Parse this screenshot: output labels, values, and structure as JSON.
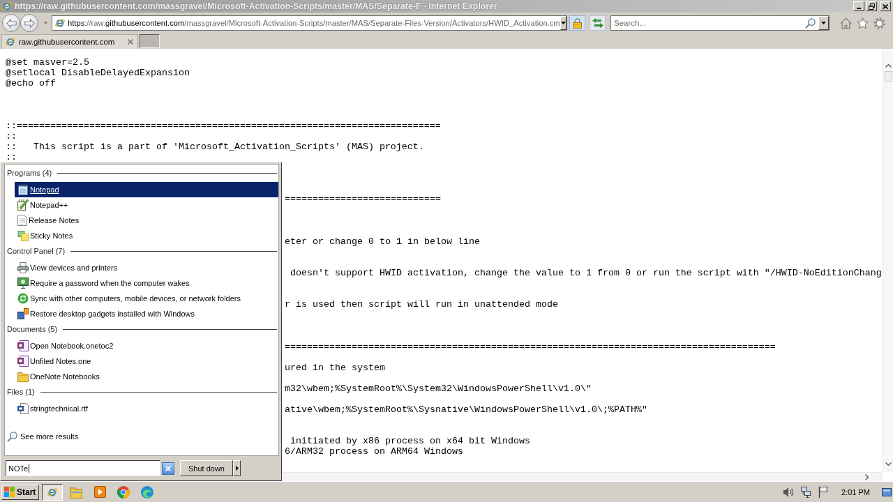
{
  "window": {
    "title": "https://raw.githubusercontent.com/massgravel/Microsoft-Activation-Scripts/master/MAS/Separate-F - Internet Explorer"
  },
  "address_bar": {
    "url": [
      {
        "text": "https",
        "kind": "plain"
      },
      {
        "text": "://raw.",
        "kind": "dim"
      },
      {
        "text": "githubusercontent.com",
        "kind": "plain"
      },
      {
        "text": "/massgravel/Microsoft-Activation-Scripts/master/MAS/Separate-Files-Version/Activators/HWID_Activation.cm",
        "kind": "dim"
      }
    ]
  },
  "search_box": {
    "placeholder": "Search..."
  },
  "tabs": [
    {
      "label": "raw.githubusercontent.com",
      "selected": true
    }
  ],
  "document": {
    "lines": [
      {
        "kind": "code",
        "text": "@set masver=2.5"
      },
      {
        "kind": "code",
        "text": "@setlocal DisableDelayedExpansion"
      },
      {
        "kind": "code",
        "text": "@echo off"
      },
      {
        "kind": "blank"
      },
      {
        "kind": "blank"
      },
      {
        "kind": "blank"
      },
      {
        "kind": "code",
        "text": "::============================================================================"
      },
      {
        "kind": "code",
        "text": "::"
      },
      {
        "kind": "code",
        "text": "::   This script is a part of 'Microsoft_Activation_Scripts' (MAS) project."
      },
      {
        "kind": "code",
        "text": "::"
      },
      {
        "kind": "blank"
      },
      {
        "kind": "blank"
      },
      {
        "kind": "blank"
      },
      {
        "kind": "covered",
        "text": "============================"
      },
      {
        "kind": "blank"
      },
      {
        "kind": "blank"
      },
      {
        "kind": "blank"
      },
      {
        "kind": "covered",
        "text": "eter or change 0 to 1 in below line"
      },
      {
        "kind": "blank"
      },
      {
        "kind": "blank"
      },
      {
        "kind": "covered",
        "text": " doesn't support HWID activation, change the value to 1 from 0 or run the script with \"/HWID-NoEditionChang"
      },
      {
        "kind": "blank"
      },
      {
        "kind": "blank"
      },
      {
        "kind": "covered",
        "text": "r is used then script will run in unattended mode"
      },
      {
        "kind": "blank"
      },
      {
        "kind": "blank"
      },
      {
        "kind": "blank"
      },
      {
        "kind": "covered",
        "text": "========================================================================================"
      },
      {
        "kind": "blank"
      },
      {
        "kind": "covered",
        "text": "ured in the system"
      },
      {
        "kind": "blank"
      },
      {
        "kind": "covered",
        "text": "m32\\wbem;%SystemRoot%\\System32\\WindowsPowerShell\\v1.0\\\""
      },
      {
        "kind": "blank"
      },
      {
        "kind": "covered",
        "text": "ative\\wbem;%SystemRoot%\\Sysnative\\WindowsPowerShell\\v1.0\\;%PATH%\""
      },
      {
        "kind": "blank"
      },
      {
        "kind": "blank"
      },
      {
        "kind": "covered",
        "text": " initiated by x86 process on x64 bit Windows"
      },
      {
        "kind": "covered",
        "text": "6/ARM32 process on ARM64 Windows"
      }
    ]
  },
  "start_menu": {
    "sections": [
      {
        "title": "Programs (4)",
        "items": [
          {
            "label": "Notepad",
            "selected": true
          },
          {
            "label": "Notepad++",
            "selected": false
          },
          {
            "label": "Release Notes",
            "selected": false
          },
          {
            "label": "Sticky Notes",
            "selected": false
          }
        ]
      },
      {
        "title": "Control Panel (7)",
        "items": [
          {
            "label": "View devices and printers",
            "selected": false
          },
          {
            "label": "Require a password when the computer wakes",
            "selected": false
          },
          {
            "label": "Sync with other computers, mobile devices, or network folders",
            "selected": false
          },
          {
            "label": "Restore desktop gadgets installed with Windows",
            "selected": false
          }
        ]
      },
      {
        "title": "Documents (5)",
        "items": [
          {
            "label": "Open Notebook.onetoc2",
            "selected": false
          },
          {
            "label": "Unfiled Notes.one",
            "selected": false
          },
          {
            "label": "OneNote Notebooks",
            "selected": false
          }
        ]
      },
      {
        "title": "Files (1)",
        "items": [
          {
            "label": "stringtechnical.rtf",
            "selected": false
          }
        ]
      }
    ],
    "see_more": "See more results",
    "search": {
      "value": "NOTe"
    },
    "shutdown_button": "Shut down"
  },
  "taskbar": {
    "start_button": "Start",
    "apps": [
      {
        "selected": true
      },
      {
        "selected": false
      },
      {
        "selected": false
      },
      {
        "selected": false
      },
      {
        "selected": false
      }
    ],
    "clock": "2:01 PM"
  }
}
